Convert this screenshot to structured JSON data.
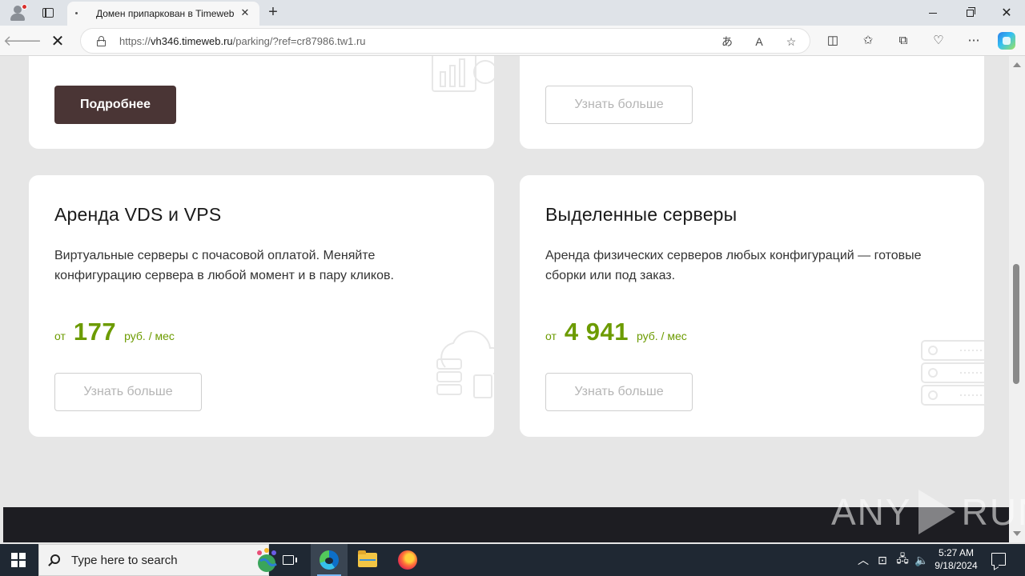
{
  "browser": {
    "tab_title": "Домен припаркован в Timeweb",
    "tab_close": "✕",
    "new_tab": "+",
    "url_prefix": "https://",
    "url_host": "vh346.timeweb.ru",
    "url_rest": "/parking/?ref=cr87986.tw1.ru",
    "window_close": "✕",
    "icons": [
      "profile-icon",
      "tab-actions-icon",
      "back-icon",
      "stop-loading-icon",
      "lock-icon",
      "translate-icon",
      "read-aloud-icon",
      "favorite-star-icon",
      "split-screen-icon",
      "favorites-icon",
      "collections-icon",
      "performance-icon",
      "more-icon",
      "copilot-icon"
    ]
  },
  "cards_top": {
    "left_button": "Подробнее",
    "right_button": "Узнать больше"
  },
  "cards": [
    {
      "title": "Аренда VDS и VPS",
      "description": "Виртуальные серверы с почасовой оплатой. Меняйте конфигурацию сервера в любой момент и в пару кликов.",
      "price_from": "от",
      "price_amount": "177",
      "price_unit": "руб. / мес",
      "button": "Узнать больше"
    },
    {
      "title": "Выделенные серверы",
      "description": "Аренда физических серверов любых конфигураций — готовые сборки или под заказ.",
      "price_from": "от",
      "price_amount": "4 941",
      "price_unit": "руб. / мес",
      "button": "Узнать больше"
    }
  ],
  "watermark": {
    "left": "ANY",
    "right": "RUN"
  },
  "taskbar": {
    "search_placeholder": "Type here to search",
    "time": "5:27 AM",
    "date": "9/18/2024"
  },
  "colors": {
    "accent_price": "#6c9b00",
    "dark_button": "#4a3535",
    "page_background": "#e6e6e6"
  }
}
